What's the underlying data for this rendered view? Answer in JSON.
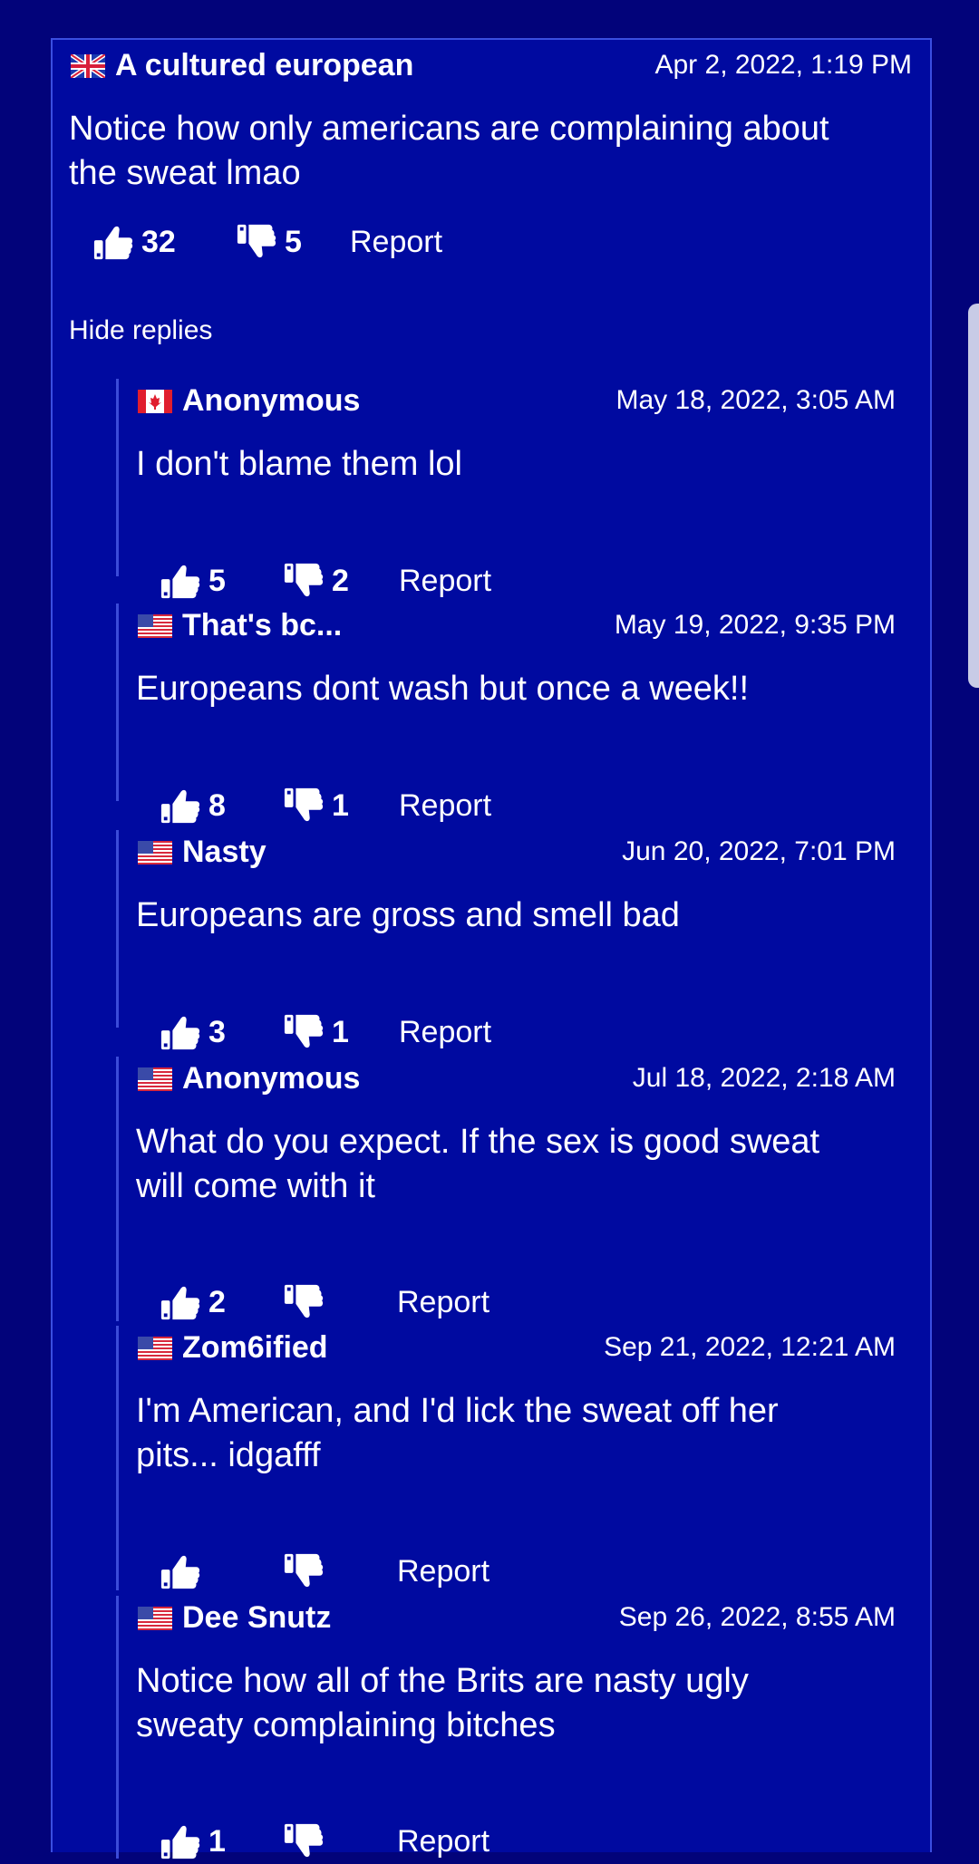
{
  "colors": {
    "background": "#02037a",
    "panel": "#000aa0",
    "border": "#3a4ee0",
    "text": "#ffffff"
  },
  "top_comment": {
    "flag": "uk-flag-icon",
    "author": "A cultured european",
    "time": "Apr 2, 2022, 1:19 PM",
    "text_line1": "Notice how only americans are complaining about",
    "text_line2": "the sweat lmao",
    "likes": "32",
    "dislikes": "5",
    "report": "Report"
  },
  "hide_replies": "Hide replies",
  "replies": [
    {
      "flag": "canada-flag-icon",
      "author": "Anonymous",
      "time": "May 18, 2022, 3:05 AM",
      "text_line1": "I don't blame them lol",
      "text_line2": "",
      "likes": "5",
      "dislikes": "2",
      "report": "Report"
    },
    {
      "flag": "us-flag-icon",
      "author": "That's bc...",
      "time": "May 19, 2022, 9:35 PM",
      "text_line1": "Europeans dont wash but once a week!!",
      "text_line2": "",
      "likes": "8",
      "dislikes": "1",
      "report": "Report"
    },
    {
      "flag": "us-flag-icon",
      "author": "Nasty",
      "time": "Jun 20, 2022, 7:01 PM",
      "text_line1": "Europeans are gross and smell bad",
      "text_line2": "",
      "likes": "3",
      "dislikes": "1",
      "report": "Report"
    },
    {
      "flag": "us-flag-icon",
      "author": "Anonymous",
      "time": "Jul 18, 2022, 2:18 AM",
      "text_line1": "What do you expect. If the sex is good sweat",
      "text_line2": "will come with it",
      "likes": "2",
      "dislikes": "",
      "report": "Report"
    },
    {
      "flag": "us-flag-icon",
      "author": "Zom6ified",
      "time": "Sep 21, 2022, 12:21 AM",
      "text_line1": "I'm American, and I'd lick the sweat off her",
      "text_line2": "pits... idgafff",
      "likes": "",
      "dislikes": "",
      "report": "Report"
    },
    {
      "flag": "us-flag-icon",
      "author": "Dee Snutz",
      "time": "Sep 26, 2022, 8:55 AM",
      "text_line1": "Notice how all of the Brits are nasty ugly",
      "text_line2": "sweaty complaining bitches",
      "likes": "1",
      "dislikes": "",
      "report": "Report"
    }
  ]
}
